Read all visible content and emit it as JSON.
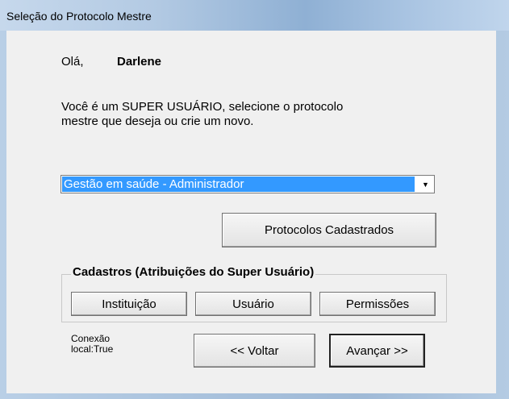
{
  "window": {
    "title": "Seleção do Protocolo Mestre"
  },
  "greeting": {
    "hello": "Olá,",
    "username": "Darlene"
  },
  "message": {
    "line1": "Você é um SUPER USUÁRIO, selecione o protocolo",
    "line2": "mestre que deseja ou crie um novo."
  },
  "protocol_select": {
    "selected_value": "Gestão em saúde - Administrador",
    "arrow_icon": "chevron-down-icon"
  },
  "buttons": {
    "protocolos_cadastrados": "Protocolos Cadastrados",
    "voltar": "<< Voltar",
    "avancar": "Avançar >>"
  },
  "cadastros": {
    "legend": "Cadastros (Atribuições do Super Usuário)",
    "instituicao": "Instituição",
    "usuario": "Usuário",
    "permissoes": "Permissões"
  },
  "status": {
    "conexao_line1": "Conexão",
    "conexao_line2": "local:True"
  }
}
